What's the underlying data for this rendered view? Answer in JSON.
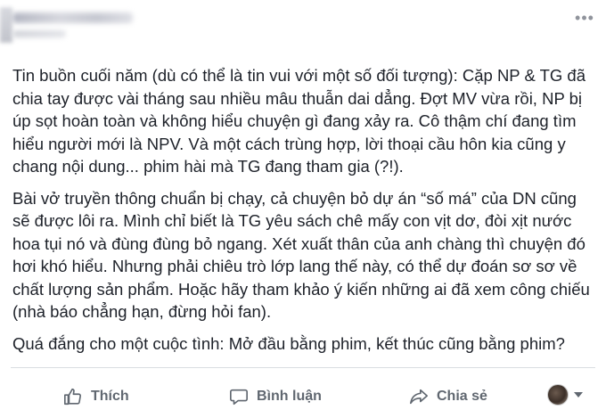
{
  "post": {
    "paragraphs": [
      "Tin buồn cuối năm (dù có thể là tin vui với một số đối tượng): Cặp NP & TG đã chia tay được vài tháng sau nhiều mâu thuẫn dai dẳng. Đợt MV vừa rồi, NP bị úp sọt hoàn toàn và không hiểu chuyện gì đang xảy ra. Cô thậm chí đang tìm hiểu người mới là NPV. Và một cách trùng hợp, lời thoại cầu hôn kia cũng y chang nội dung... phim hài mà TG đang tham gia (?!).",
      "Bài vở truyền thông chuẩn bị chạy, cả chuyện bỏ dự án “số má” của DN cũng sẽ được lôi ra. Mình chỉ biết là TG yêu sách chê mấy con vịt dơ, đòi xịt nước hoa tụi nó và đùng đùng bỏ ngang. Xét xuất thân của anh chàng thì chuyện đó hơi khó hiểu. Nhưng phải chiêu trò lớp lang thế này, có thể dự đoán sơ sơ về chất lượng sản phẩm. Hoặc hãy tham khảo ý kiến những ai đã xem công chiếu (nhà báo chẳng hạn, đừng hỏi fan).",
      "Quá đắng cho một cuộc tình: Mở đầu bằng phim, kết thúc cũng bằng phim?"
    ]
  },
  "header": {
    "more_icon": "more-options-icon"
  },
  "actions": {
    "like_label": "Thích",
    "comment_label": "Bình luận",
    "share_label": "Chia sẻ",
    "like_icon": "thumbs-up-icon",
    "comment_icon": "comment-icon",
    "share_icon": "share-icon"
  },
  "colors": {
    "text": "#1d2129",
    "action_text": "#606770",
    "divider": "#dadde1"
  }
}
